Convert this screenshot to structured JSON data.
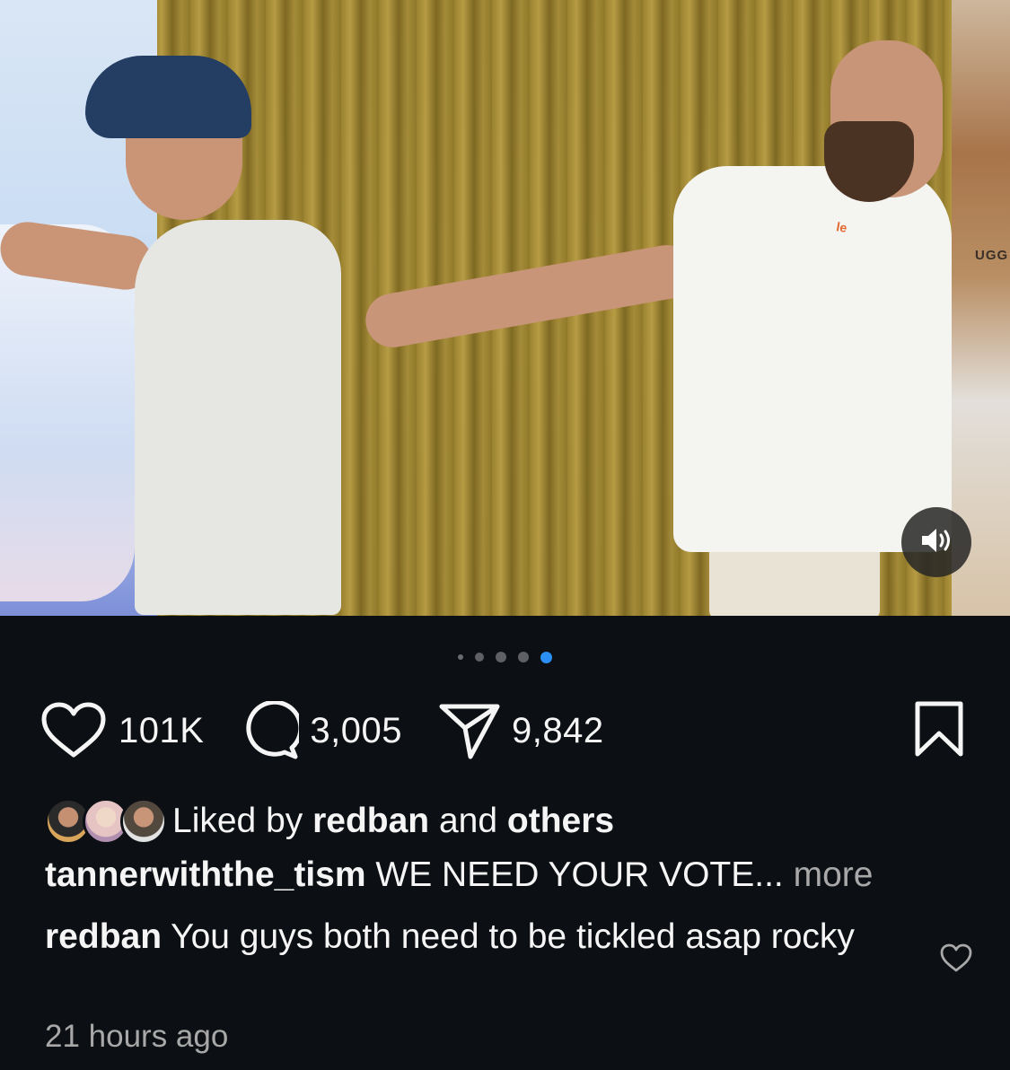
{
  "post": {
    "store_sign": "UGG",
    "shirt_print": "le",
    "carousel": {
      "count": 5,
      "active_index": 4
    },
    "actions": {
      "likes": "101K",
      "comments": "3,005",
      "shares": "9,842"
    },
    "liked_by": {
      "prefix": "Liked by ",
      "user": "redban",
      "middle": " and ",
      "others": "others"
    },
    "caption": {
      "username": "tannerwiththe_tism",
      "text": " WE NEED YOUR VOTE...",
      "more": " more"
    },
    "comment": {
      "username": "redban",
      "text": " You guys both need to be tickled asap rocky"
    },
    "timestamp": "21 hours ago"
  },
  "colors": {
    "background": "#0c0f14",
    "active_dot": "#2b8ff5",
    "muted_text": "#a8a8a8"
  },
  "icons": [
    "volume-icon",
    "heart-icon",
    "comment-icon",
    "share-icon",
    "bookmark-icon",
    "comment-like-heart-icon"
  ]
}
